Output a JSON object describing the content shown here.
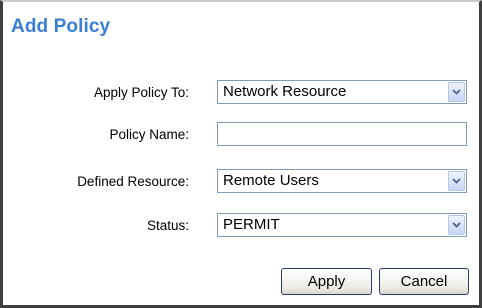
{
  "dialog": {
    "title": "Add Policy"
  },
  "form": {
    "apply_policy_to": {
      "label": "Apply Policy To:",
      "value": "Network Resource"
    },
    "policy_name": {
      "label": "Policy Name:",
      "value": "",
      "placeholder": ""
    },
    "defined_resource": {
      "label": "Defined Resource:",
      "value": "Remote Users"
    },
    "status": {
      "label": "Status:",
      "value": "PERMIT"
    }
  },
  "buttons": {
    "apply": "Apply",
    "cancel": "Cancel"
  },
  "icons": {
    "dropdown": "chevron-down-icon"
  },
  "colors": {
    "title": "#3a7fd0",
    "field_border": "#7f9db9",
    "button_border": "#2c3c6a"
  }
}
